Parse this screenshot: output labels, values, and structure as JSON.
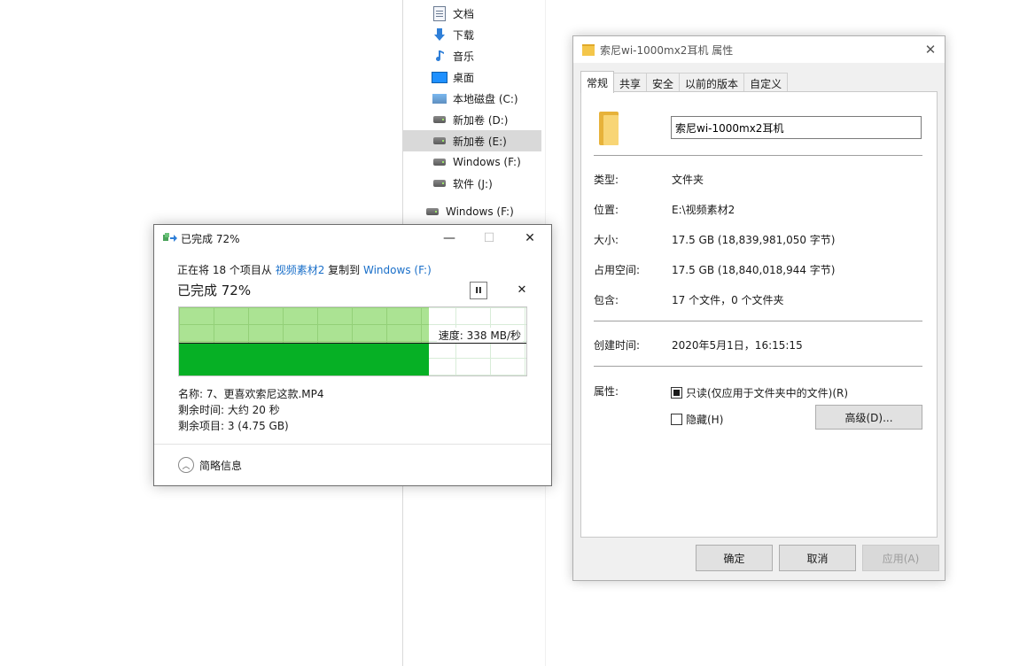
{
  "nav_pane": {
    "items": [
      {
        "label": "文档",
        "icon": "document-icon"
      },
      {
        "label": "下载",
        "icon": "download-icon"
      },
      {
        "label": "音乐",
        "icon": "music-icon"
      },
      {
        "label": "桌面",
        "icon": "desktop-icon"
      },
      {
        "label": "本地磁盘 (C:)",
        "icon": "system-drive-icon"
      },
      {
        "label": "新加卷 (D:)",
        "icon": "drive-icon"
      },
      {
        "label": "新加卷 (E:)",
        "icon": "drive-icon",
        "selected": true
      },
      {
        "label": "Windows (F:)",
        "icon": "drive-icon"
      },
      {
        "label": "软件 (J:)",
        "icon": "drive-icon"
      },
      {
        "label": "Windows (F:)",
        "icon": "drive-icon"
      }
    ]
  },
  "copy_dialog": {
    "title": "已完成 72%",
    "line_prefix": "正在将 18 个项目从 ",
    "source": "视频素材2",
    "line_middle": " 复制到 ",
    "destination": "Windows (F:)",
    "percent_text": "已完成 72%",
    "progress_fraction": 0.72,
    "speed": "速度: 338 MB/秒",
    "name_line": "名称: 7、更喜欢索尼这款.MP4",
    "time_line": "剩余时间: 大约 20 秒",
    "items_line": "剩余项目: 3 (4.75 GB)",
    "footer_label": "简略信息",
    "minimize_glyph": "—",
    "maximize_glyph": "☐",
    "close_glyph": "✕",
    "pause_glyph": "II",
    "cancel_glyph": "✕",
    "colors": {
      "progress_dark": "#06b025",
      "progress_light": "#a7e28d",
      "link": "#1a6fc9"
    }
  },
  "properties_dialog": {
    "title": "索尼wi-1000mx2耳机 属性",
    "close_glyph": "✕",
    "tabs": [
      "常规",
      "共享",
      "安全",
      "以前的版本",
      "自定义"
    ],
    "active_tab": "常规",
    "folder_name": "索尼wi-1000mx2耳机",
    "rows": {
      "type": {
        "label": "类型:",
        "value": "文件夹"
      },
      "location": {
        "label": "位置:",
        "value": "E:\\视频素材2"
      },
      "size": {
        "label": "大小:",
        "value": "17.5 GB (18,839,981,050 字节)"
      },
      "size_on_disk": {
        "label": "占用空间:",
        "value": "17.5 GB (18,840,018,944 字节)"
      },
      "contains": {
        "label": "包含:",
        "value": "17 个文件，0 个文件夹"
      },
      "created": {
        "label": "创建时间:",
        "value": "2020年5月1日，16:15:15"
      },
      "attributes": {
        "label": "属性:"
      }
    },
    "readonly_label": "只读(仅应用于文件夹中的文件)(R)",
    "hidden_label": "隐藏(H)",
    "advanced_button": "高级(D)...",
    "ok_button": "确定",
    "cancel_button": "取消",
    "apply_button": "应用(A)"
  }
}
